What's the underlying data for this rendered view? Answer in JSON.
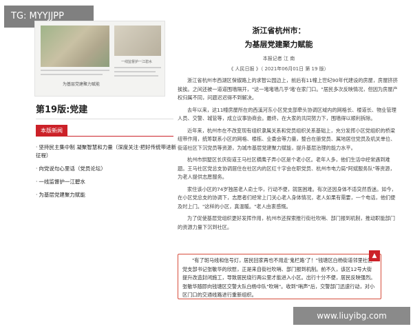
{
  "tag": "TG: MYYJJPP",
  "thumbnail": {
    "caption": "为基层党建聚力赋能",
    "side_caption": "一线监督护一江碧水"
  },
  "edition": "第19版:党建",
  "section": {
    "badge": "本版新闻",
    "items": [
      "坚持民主集中制 凝聚智慧和力量（深度关注·把好传统带进新征程）",
      "向党说句心里话（党员论坛）",
      "一线监督护一江碧水",
      "为基层党建聚力赋能"
    ]
  },
  "article": {
    "kicker": "浙江省杭州市：",
    "headline": "为基层党建聚力赋能",
    "reporter": "本报记者 江 南",
    "source": "《 人民日报 》（ 2021年06月01日   第 19 版）",
    "paragraphs": [
      "浙江省杭州市西湖区保俶路上的求智公园边上，前后有11幢上世纪90年代建设的房屋，房屋挤挤挨挨。之间还被一道道围墙隔开，\"这一堵堵墙几乎'堵'在家门口。\"居民多次反映情况，但因为房屋产权归属不同，问题迟迟得不到解决。",
      "去年以来，这11幢房屋所在的西溪河东小区党支部牵头协调区域内的网格长、楼道长、物业管理人员、交警、城管等，成立议事协商会。最终，在大家的共同努力下，围墙得以顺利拆除。",
      "近年来，杭州市在不改变现有组织隶属关系和党员组织关系基础上，充分发挥小区党组织的桥梁纽带作用，统筹联系小区的网格、楼栋、业委会等力量，整合在册党员、属地居住党员及机关单位、街道社区下沉党员等资源，为城市基层党建聚力赋能，提升基层治理的能力水平。",
      "杭州市拱墅区长庆街道王马社区横鹰子弄小区是个老小区。老年人多，他们生活中经常遇到难题。王马社区党总支协调居住在社区内的区红十字会在职党员、杭州市电力局\"阿斌服务队\"等资源，为老人提供志愿服务。",
      "家住该小区的74岁独居老人俞士华，行动不便，就医困难。有次还因身体不适突然昏迷。如今，在小区党总支的协调下，志愿者们经常上门关心老人身体情况，老人如果有需要，一个电话，他们便及时上门。\"这样的小区，真温暖。\"老人由衷感慨。",
      "为了促使基层党组织更好发挥作用，杭州市还探索推行街社吹哨、部门报到机制，推动职能部门的资源力量下沉到社区。"
    ],
    "highlight": "\"有了斑马线和信号灯，居民回家再也不用走'鬼栏路'了！\"钱塘区白杨街道邻里社区党支部书记张敏华的欣慰，正是来自街社吹哨、部门报到机制。前不久，该区12号大街提升改造封闭施工，导致居民绕行两公里才能进入小区。出行十分不便，居民反映强烈。张敏华随即向钱塘区交警大队白杨中队\"吹哨\"。收到\"哨声\"后，交警部门迅速行动，对小区门口的交通线路进行重新组织。"
  },
  "back_to_top": "▲",
  "watermark": "www.liuyibg.com"
}
